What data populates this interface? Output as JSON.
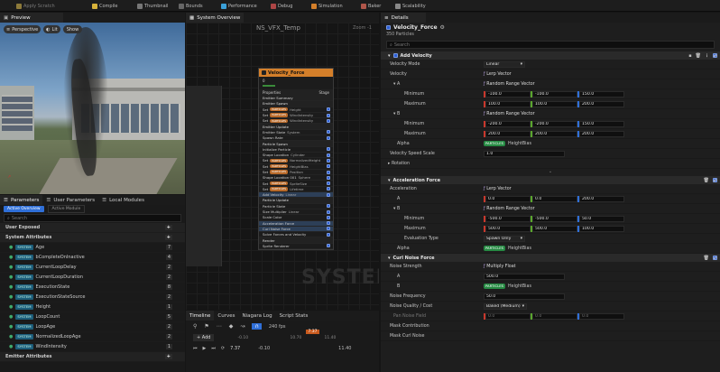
{
  "toolbar": {
    "items": [
      "Apply Scratch",
      "Compile",
      "Thumbnail",
      "Bounds",
      "Performance",
      "Debug",
      "Simulation",
      "Baker",
      "Scalability"
    ]
  },
  "preview": {
    "tab": "Preview",
    "buttons": [
      "Perspective",
      "Lit",
      "Show"
    ]
  },
  "system_overview": {
    "tab": "System Overview",
    "title": "NS_VFX_Temp",
    "zoom": "Zoom -1",
    "watermark": "SYSTEM"
  },
  "node": {
    "title": "Velocity_Force",
    "num": "0",
    "header_left": "Properties",
    "header_right": "Stage",
    "rows": [
      {
        "t": "Emitter Summary",
        "k": "h"
      },
      {
        "t": "Emitter Spawn",
        "k": "h"
      },
      {
        "t": "Set",
        "badge": "PARTICLES",
        "v": "Height",
        "k": "b"
      },
      {
        "t": "Set",
        "badge": "PARTICLES",
        "v": "WindIntensity",
        "k": "b"
      },
      {
        "t": "Set",
        "badge": "PARTICLES",
        "v": "WindIntensity",
        "k": "b"
      },
      {
        "t": "Emitter Update",
        "k": "h"
      },
      {
        "t": "Emitter State",
        "v": "System",
        "k": "b"
      },
      {
        "t": "Spawn Rate",
        "k": "n"
      },
      {
        "t": "Particle Spawn",
        "k": "h"
      },
      {
        "t": "Initialize Particle",
        "k": "n"
      },
      {
        "t": "Shape Location",
        "v": "Cylinder",
        "k": "n"
      },
      {
        "t": "Set",
        "badge": "PARTICLES",
        "v": "NormalizedHeight",
        "k": "b"
      },
      {
        "t": "Set",
        "badge": "PARTICLES",
        "v": "HeightBias",
        "k": "b"
      },
      {
        "t": "Set",
        "badge": "PARTICLES",
        "v": "Position",
        "k": "b"
      },
      {
        "t": "Shape Location 001",
        "v": "Sphere",
        "k": "n"
      },
      {
        "t": "Set",
        "badge": "PARTICLES",
        "v": "SpriteSize",
        "k": "b"
      },
      {
        "t": "Set",
        "badge": "PARTICLES",
        "v": "Lifetime",
        "k": "b"
      },
      {
        "t": "Add Velocity",
        "v": "Linear",
        "k": "s"
      },
      {
        "t": "Particle Update",
        "k": "h"
      },
      {
        "t": "Particle State",
        "k": "n"
      },
      {
        "t": "Size Multiplier",
        "v": "Linear",
        "k": "n"
      },
      {
        "t": "Scale Color",
        "k": "n"
      },
      {
        "t": "Acceleration Force",
        "k": "s"
      },
      {
        "t": "Curl Noise Force",
        "k": "s"
      },
      {
        "t": "Solve Forces and Velocity",
        "k": "n"
      },
      {
        "t": "Render",
        "k": "h"
      },
      {
        "t": "Sprite Renderer",
        "k": "n"
      }
    ]
  },
  "parameters": {
    "tabs": [
      "Parameters",
      "User Parameters",
      "Local Modules"
    ],
    "filters": [
      "Active Overview",
      "Active Module"
    ],
    "search_placeholder": "Search",
    "sections": [
      "User Exposed",
      "System Attributes",
      "Emitter Attributes"
    ],
    "items": [
      {
        "ns": "SYSTEM",
        "name": "Age",
        "n": "7"
      },
      {
        "ns": "SYSTEM",
        "name": "bCompleteOnInactive",
        "n": "4"
      },
      {
        "ns": "SYSTEM",
        "name": "CurrentLoopDelay",
        "n": "2"
      },
      {
        "ns": "SYSTEM",
        "name": "CurrentLoopDuration",
        "n": "2"
      },
      {
        "ns": "SYSTEM",
        "name": "ExecutionState",
        "n": "8"
      },
      {
        "ns": "SYSTEM",
        "name": "ExecutionStateSource",
        "n": "2"
      },
      {
        "ns": "SYSTEM",
        "name": "Height",
        "n": "1"
      },
      {
        "ns": "SYSTEM",
        "name": "LoopCount",
        "n": "5"
      },
      {
        "ns": "SYSTEM",
        "name": "LoopAge",
        "n": "2"
      },
      {
        "ns": "SYSTEM",
        "name": "NormalizedLoopAge",
        "n": "2"
      },
      {
        "ns": "SYSTEM",
        "name": "WindIntensity",
        "n": "1"
      }
    ]
  },
  "timeline": {
    "tabs": [
      "Timeline",
      "Curves",
      "Niagara Log",
      "Script Stats"
    ],
    "add": "+ Add",
    "fps": "240 fps",
    "current": "7.37",
    "range_left": "-0.10",
    "range_right": "11.40",
    "ticks": [
      "-0.10",
      "10.70",
      "11.40"
    ],
    "start": "7.37",
    "end": "-0.10"
  },
  "details": {
    "tab": "Details",
    "title": "Velocity_Force",
    "subtitle": "350 Particles",
    "search_placeholder": "Search",
    "add_velocity": {
      "header": "Add Velocity",
      "velocity_mode_label": "Velocity Mode",
      "velocity_mode": "Linear",
      "velocity_label": "Velocity",
      "velocity_value": "Lerp Vector",
      "a_label": "A",
      "a_value": "Random Range Vector",
      "min_label": "Minimum",
      "a_min": [
        "-100.0",
        "-100.0",
        "150.0"
      ],
      "max_label": "Maximum",
      "a_max": [
        "100.0",
        "100.0",
        "200.0"
      ],
      "b_label": "B",
      "b_value": "Random Range Vector",
      "b_min": [
        "-200.0",
        "-200.0",
        "150.0"
      ],
      "b_max": [
        "200.0",
        "200.0",
        "200.0"
      ],
      "alpha_label": "Alpha",
      "alpha_ns": "PARTICLES",
      "alpha_value": "HeightBias",
      "scale_label": "Velocity Speed Scale",
      "scale_value": "1.0",
      "rotation_label": "Rotation"
    },
    "accel": {
      "header": "Acceleration Force",
      "accel_label": "Acceleration",
      "accel_value": "Lerp Vector",
      "a_label": "A",
      "a": [
        "0.0",
        "0.0",
        "200.0"
      ],
      "b_label": "B",
      "b_value": "Random Range Vector",
      "min_label": "Minimum",
      "b_min": [
        "-500.0",
        "-500.0",
        "50.0"
      ],
      "max_label": "Maximum",
      "b_max": [
        "500.0",
        "500.0",
        "100.0"
      ],
      "eval_label": "Evaluation Type",
      "eval_value": "Spawn Only",
      "alpha_label": "Alpha",
      "alpha_ns": "PARTICLES",
      "alpha_value": "HeightBias"
    },
    "curl": {
      "header": "Curl Noise Force",
      "strength_label": "Noise Strength",
      "strength_value": "Multiply Float",
      "a_label": "A",
      "a_value": "500.0",
      "b_label": "B",
      "b_ns": "PARTICLES",
      "b_value": "HeightBias",
      "freq_label": "Noise Frequency",
      "freq_value": "50.0",
      "quality_label": "Noise Quality / Cost",
      "quality_value": "Baked (Medium)",
      "pan_label": "Pan Noise Field",
      "pan": [
        "0.0",
        "0.0",
        "0.0"
      ],
      "mask_label": "Mask Contribution",
      "mask2_label": "Mask Curl Noise"
    }
  }
}
